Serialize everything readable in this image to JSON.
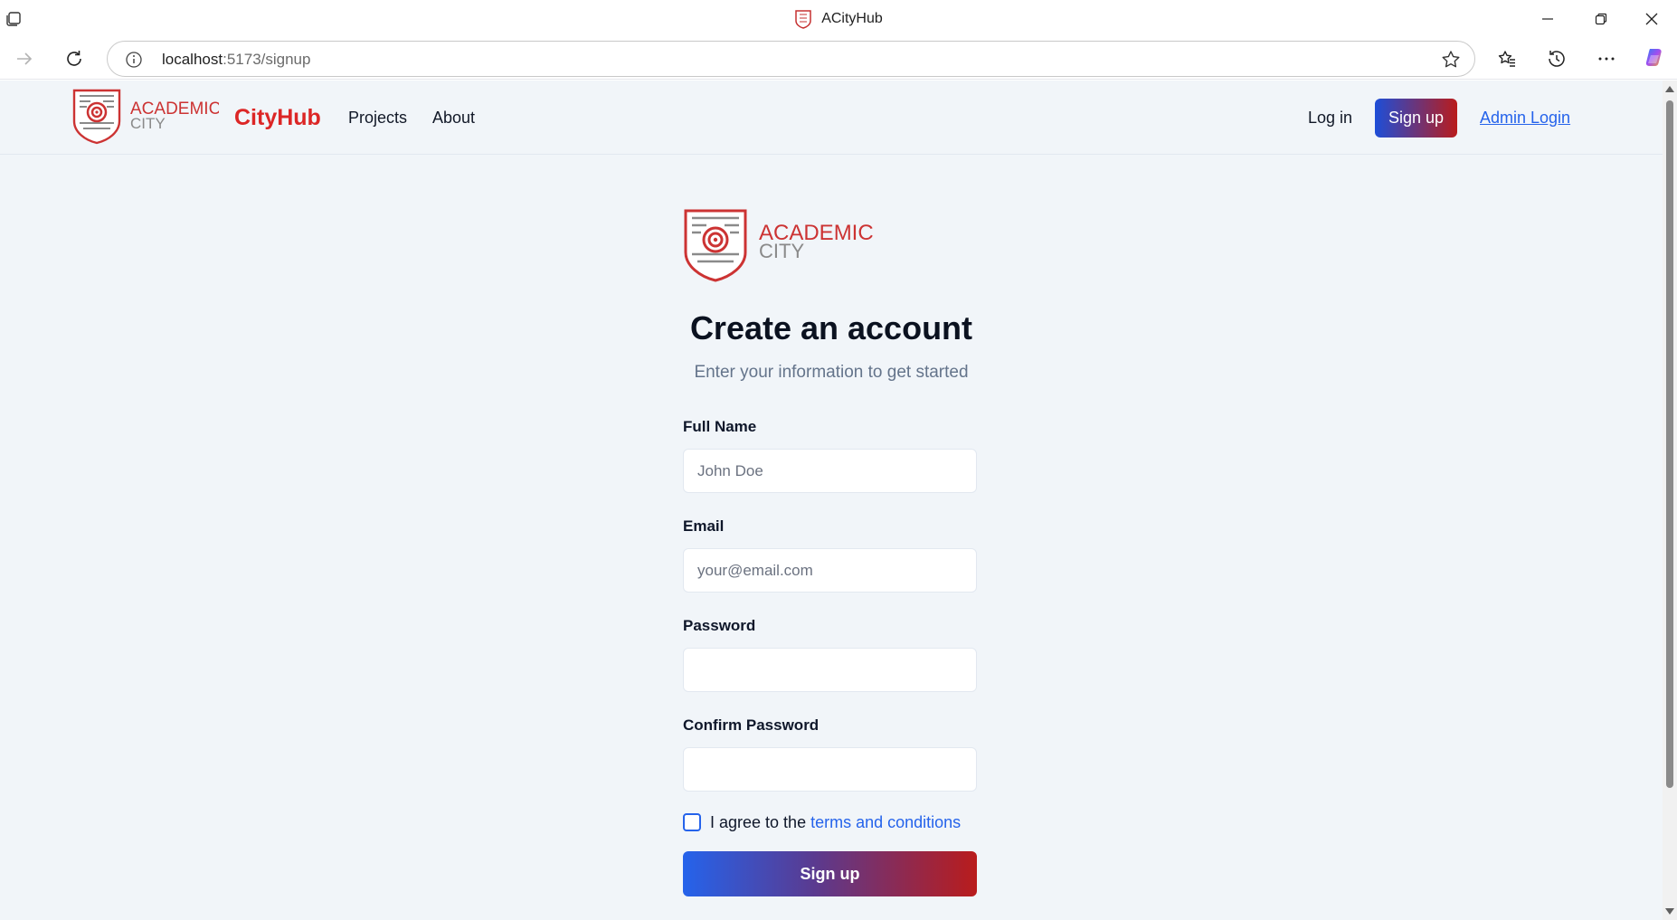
{
  "browser": {
    "tab_title": "ACityHub",
    "url_host": "localhost",
    "url_rest": ":5173/signup"
  },
  "header": {
    "logo_line1": "ACADEMIC",
    "logo_line2": "CITY",
    "brand": "CityHub",
    "nav": {
      "projects": "Projects",
      "about": "About"
    },
    "login": "Log in",
    "signup": "Sign up",
    "admin_login": "Admin Login"
  },
  "form": {
    "logo_line1": "ACADEMIC",
    "logo_line2": "CITY",
    "title": "Create an account",
    "subtitle": "Enter your information to get started",
    "full_name": {
      "label": "Full Name",
      "placeholder": "John Doe",
      "value": ""
    },
    "email": {
      "label": "Email",
      "placeholder": "your@email.com",
      "value": ""
    },
    "password": {
      "label": "Password",
      "value": ""
    },
    "confirm_password": {
      "label": "Confirm Password",
      "value": ""
    },
    "agree_prefix": "I agree to the ",
    "agree_link": "terms and conditions",
    "submit": "Sign up"
  },
  "colors": {
    "brand_red": "#dc2626",
    "accent_blue": "#2563eb",
    "page_bg": "#f1f5f9"
  }
}
